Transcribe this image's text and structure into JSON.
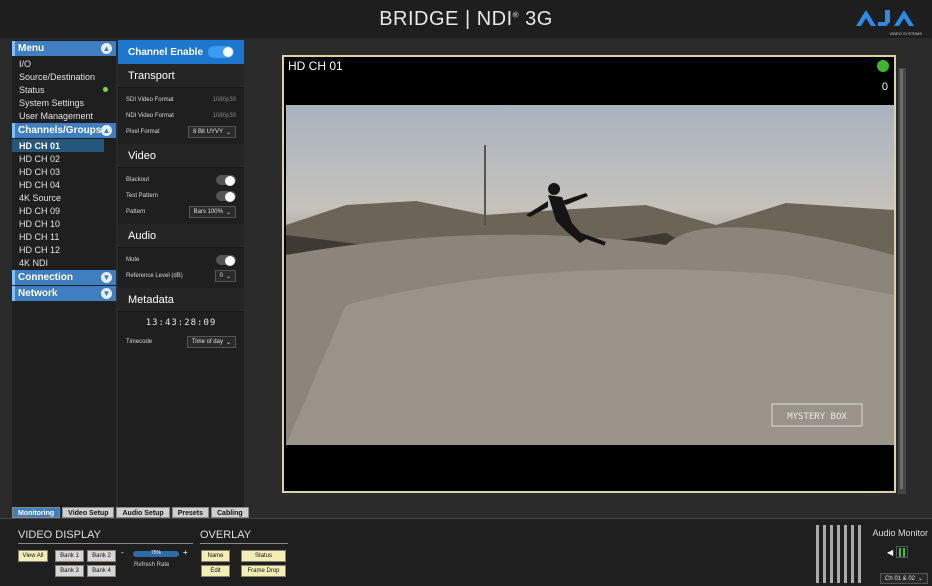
{
  "header": {
    "title": "BRIDGE | NDI",
    "title_sup": "®",
    "title_suffix": " 3G",
    "logo_sub": "VIDEO SYSTEMS"
  },
  "sidebar": {
    "menu": "Menu",
    "items": [
      "I/O",
      "Source/Destination",
      "Status",
      "System Settings",
      "User Management"
    ],
    "channels_groups": "Channels/Groups",
    "channels": [
      "HD CH 01",
      "HD CH 02",
      "HD CH 03",
      "HD CH 04",
      "4K Source",
      "HD CH 09",
      "HD CH 10",
      "HD CH 11",
      "HD CH 12",
      "4K NDI"
    ],
    "connection": "Connection",
    "network": "Network"
  },
  "panel": {
    "channel_enable": "Channel Enable",
    "transport": "Transport",
    "sdi_format_label": "SDI Video Format",
    "sdi_format_value": "1080p30",
    "ndi_format_label": "NDI Video Format",
    "ndi_format_value": "1080p30",
    "pixel_format_label": "Pixel Format",
    "pixel_format_value": "8 Bit UYVY",
    "video": "Video",
    "blackout": "Blackout",
    "test_pattern": "Test Pattern",
    "pattern_label": "Pattern",
    "pattern_value": "Bars 100%",
    "audio": "Audio",
    "mute": "Mute",
    "ref_level_label": "Reference Level (dB)",
    "ref_level_value": "0",
    "metadata": "Metadata",
    "timecode_value": "13:43:28:09",
    "timecode_label": "Timecode",
    "timecode_select": "Time of day"
  },
  "viewer": {
    "label": "HD CH 01",
    "count": "0",
    "watermark": "MYSTERY BOX"
  },
  "tabs": [
    "Monitoring",
    "Video Setup",
    "Audio Setup",
    "Presets",
    "Cabling"
  ],
  "bottom": {
    "video_display": "VIDEO DISPLAY",
    "overlay": "OVERLAY",
    "view_all": "View All",
    "bank1": "Bank 1",
    "bank2": "Bank 2",
    "bank3": "Bank 3",
    "bank4": "Bank 4",
    "minus": "-",
    "plus": "+",
    "rate_value": "75%",
    "refresh_rate": "Refresh Rate",
    "name": "Name",
    "status": "Status",
    "edit": "Edit",
    "frame_drop": "Frame Drop",
    "audio_monitor": "Audio Monitor",
    "channel_select": "Ch 01 & 02"
  },
  "colors": {
    "accent": "#3f7fc1",
    "status_green": "#3eb52e"
  }
}
